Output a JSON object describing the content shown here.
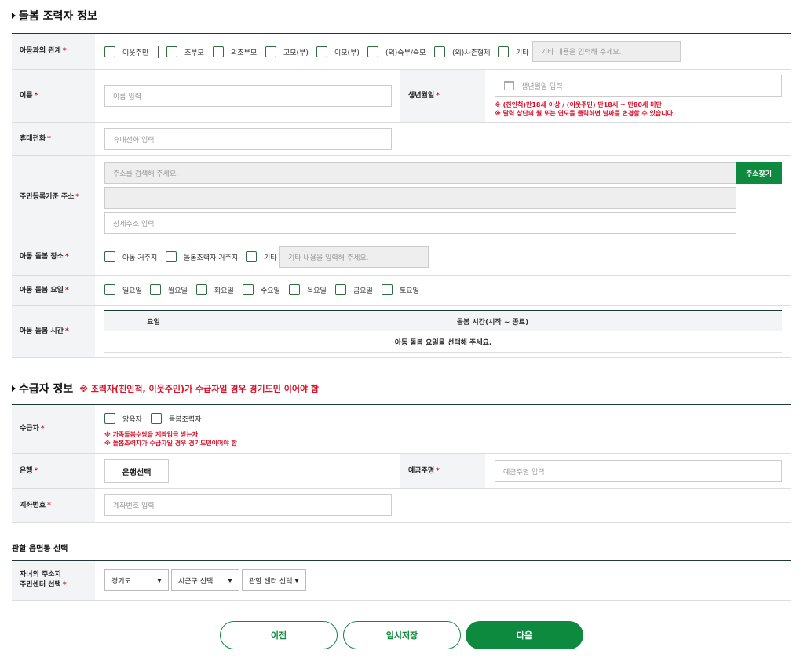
{
  "caregiver": {
    "title": "돌봄 조력자 정보",
    "relation": {
      "label": "아동과의 관계",
      "options": [
        "이웃주민",
        "조부모",
        "외조부모",
        "고모(부)",
        "이모(부)",
        "(외)숙부/숙모",
        "(외)사촌형제",
        "기타"
      ],
      "other_placeholder": "기타 내용을 입력해 주세요."
    },
    "name": {
      "label": "이름",
      "placeholder": "이름 입력"
    },
    "birth": {
      "label": "생년월일",
      "placeholder": "생년월일 입력",
      "warn1": "※ (친인척)만18세 이상 / (이웃주민) 만18세 ~ 만80세 미만",
      "warn2": "※ 달력 상단의 월 또는 연도를 클릭하면 날짜를 변경할 수 있습니다."
    },
    "phone": {
      "label": "휴대전화",
      "placeholder": "휴대전화 입력"
    },
    "address": {
      "label": "주민등록기준 주소",
      "search_placeholder": "주소를 검색해 주세요.",
      "search_button": "주소찾기",
      "detail_placeholder": "상세주소 입력"
    },
    "place": {
      "label": "아동 돌봄 장소",
      "options": [
        "아동 거주지",
        "돌봄조력자 거주지",
        "기타"
      ],
      "other_placeholder": "기타 내용을 입력해 주세요."
    },
    "days": {
      "label": "아동 돌봄 요일",
      "options": [
        "일요일",
        "월요일",
        "화요일",
        "수요일",
        "목요일",
        "금요일",
        "토요일"
      ]
    },
    "time": {
      "label": "아동 돌봄 시간",
      "col_day": "요일",
      "col_time": "돌봄 시간(시작 ~ 종료)",
      "empty": "아동 돌봄 요일을 선택해 주세요."
    }
  },
  "recipient": {
    "title": "수급자 정보",
    "note": "※ 조력자(친인척, 이웃주민)가 수급자일 경우 경기도민 이어야 함",
    "who": {
      "label": "수급자",
      "options": [
        "양육자",
        "돌봄조력자"
      ],
      "warn1": "※ 가족돌봄수당을 계좌입금 받는자",
      "warn2": "※ 돌봄조력자가 수급자일 경우 경기도민이어야 함"
    },
    "bank": {
      "label": "은행",
      "button": "은행선택"
    },
    "holder": {
      "label": "예금주명",
      "placeholder": "예금주명 입력"
    },
    "account": {
      "label": "계좌번호",
      "placeholder": "계좌번호 입력"
    }
  },
  "district": {
    "title": "관할 읍면동 선택",
    "label_line1": "자녀의 주소지",
    "label_line2": "주민센터 선택",
    "province": "경기도",
    "city": "시군구 선택",
    "center": "관할 센터 선택"
  },
  "actions": {
    "prev": "이전",
    "save": "임시저장",
    "next": "다음"
  },
  "colors": {
    "accent": "#0d8a3e",
    "required": "#d9112a",
    "header_line": "#1c3a3a"
  }
}
